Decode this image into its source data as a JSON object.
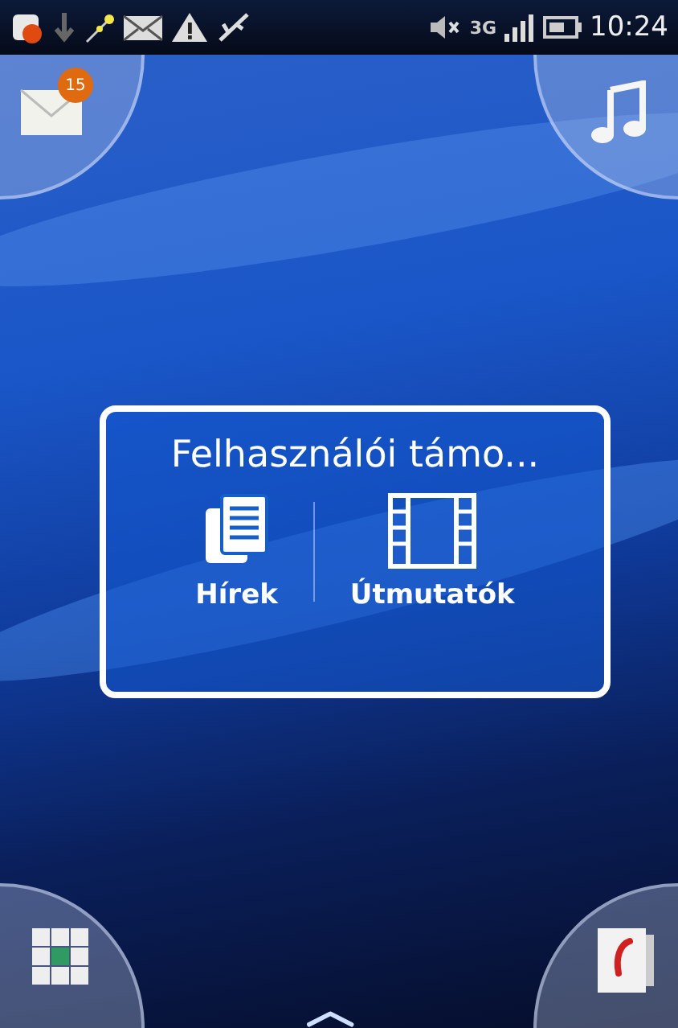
{
  "status_bar": {
    "network": "3G",
    "time": "10:24"
  },
  "corners": {
    "messaging_badge": "15"
  },
  "widget": {
    "title": "Felhasználói támo...",
    "items": [
      {
        "kind": "news",
        "label": "Hírek"
      },
      {
        "kind": "film",
        "label": "Útmutatók"
      }
    ]
  },
  "launcher": {
    "open_icon": "︿"
  }
}
